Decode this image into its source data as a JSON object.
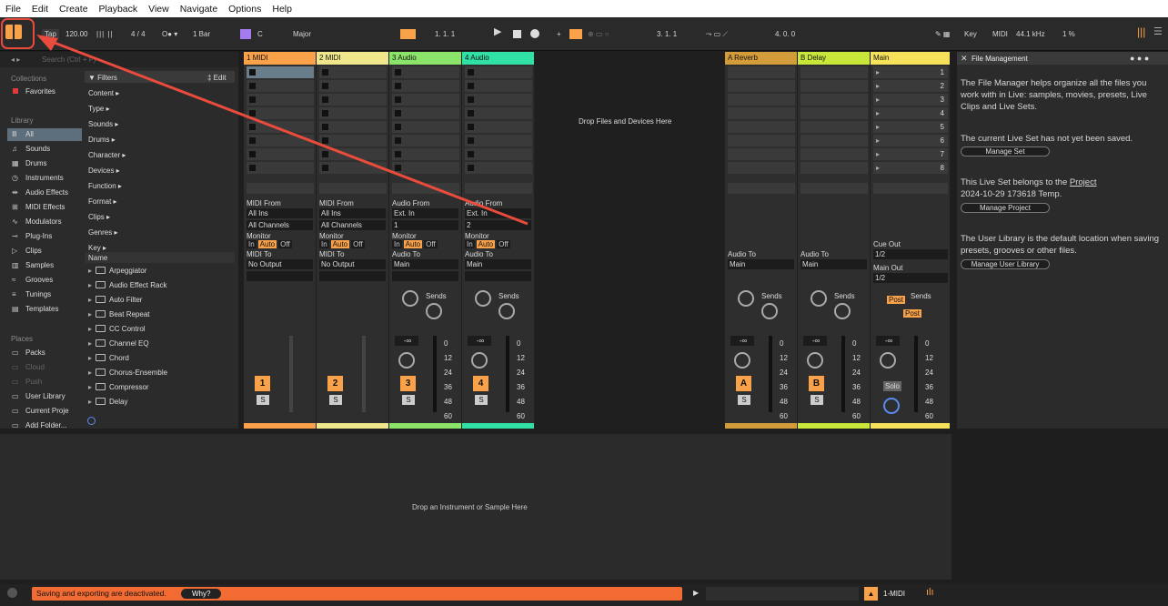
{
  "menu": [
    "File",
    "Edit",
    "Create",
    "Playback",
    "View",
    "Navigate",
    "Options",
    "Help"
  ],
  "toolbar": {
    "tap": "Tap",
    "tempo": "120.00",
    "sig": "4 / 4",
    "quant": "1 Bar",
    "key": "C",
    "scale": "Major",
    "pos1": "1.   1.   1",
    "pos2": "3.   1.   1",
    "pos3": "4.   0.   0",
    "key_label": "Key",
    "midi_label": "MIDI",
    "rate": "44.1 kHz",
    "cpu": "1 %"
  },
  "browser": {
    "search_placeholder": "Search (Ctrl + F)",
    "collections_head": "Collections",
    "favorites": "Favorites",
    "library_head": "Library",
    "library": [
      "All",
      "Sounds",
      "Drums",
      "Instruments",
      "Audio Effects",
      "MIDI Effects",
      "Modulators",
      "Plug-Ins",
      "Clips",
      "Samples",
      "Grooves",
      "Tunings",
      "Templates"
    ],
    "places_head": "Places",
    "places": [
      "Packs",
      "Cloud",
      "Push",
      "User Library",
      "Current Proje",
      "Add Folder..."
    ],
    "filters_label": "Filters",
    "edit_label": "Edit",
    "filters": [
      "Content ▸",
      "Type ▸",
      "Sounds ▸",
      "Drums ▸",
      "Character ▸",
      "Devices ▸",
      "Function ▸",
      "Format ▸",
      "Clips ▸",
      "Genres ▸",
      "Key ▸"
    ],
    "name_col": "Name",
    "devices": [
      "Arpeggiator",
      "Audio Effect Rack",
      "Auto Filter",
      "Beat Repeat",
      "CC Control",
      "Channel EQ",
      "Chord",
      "Chorus-Ensemble",
      "Compressor",
      "Delay"
    ]
  },
  "tracks": [
    {
      "name": "1 MIDI",
      "color": "#f9a24a",
      "from": "MIDI From",
      "in": "All Ins",
      "ch": "All Channels",
      "to": "MIDI To",
      "out": "No Output",
      "num": "1"
    },
    {
      "name": "2 MIDI",
      "color": "#f0e68c",
      "from": "MIDI From",
      "in": "All Ins",
      "ch": "All Channels",
      "to": "MIDI To",
      "out": "No Output",
      "num": "2"
    },
    {
      "name": "3 Audio",
      "color": "#8be36a",
      "from": "Audio From",
      "in": "Ext. In",
      "ch": "1",
      "to": "Audio To",
      "out": "Main",
      "num": "3"
    },
    {
      "name": "4 Audio",
      "color": "#31e0a4",
      "from": "Audio From",
      "in": "Ext. In",
      "ch": "2",
      "to": "Audio To",
      "out": "Main",
      "num": "4"
    }
  ],
  "returns": [
    {
      "name": "A Reverb",
      "color": "#d39c3a",
      "to": "Audio To",
      "out": "Main",
      "num": "A"
    },
    {
      "name": "B Delay",
      "color": "#c9e63a",
      "to": "Audio To",
      "out": "Main",
      "num": "B"
    }
  ],
  "main": {
    "name": "Main",
    "color": "#f5e25a",
    "scenes": [
      "1",
      "2",
      "3",
      "4",
      "5",
      "6",
      "7",
      "8"
    ],
    "cue": "Cue Out",
    "cue_val": "1/2",
    "main_out": "Main Out",
    "main_val": "1/2",
    "solo": "Solo",
    "post": "Post"
  },
  "mixer": {
    "monitor": "Monitor",
    "in": "In",
    "auto": "Auto",
    "off": "Off",
    "sends": "Sends",
    "inf": "-∞",
    "s": "S",
    "scale": [
      "0",
      "12",
      "24",
      "36",
      "48",
      "60"
    ]
  },
  "drop_files": "Drop Files and Devices Here",
  "drop_instrument": "Drop an Instrument or Sample Here",
  "info": {
    "title": "File Management",
    "p1": "The File Manager helps organize all the files you work with in Live: samples, movies, presets, Live Clips and Live Sets.",
    "p2": "The current Live Set has not yet been saved.",
    "b1": "Manage Set",
    "p3a": "This Live Set belongs to the",
    "p3link": "Project",
    "p3b": "2024-10-29 173618 Temp.",
    "b2": "Manage Project",
    "p4": "The User Library is the default location when saving presets, grooves or other files.",
    "b3": "Manage User Library"
  },
  "status": {
    "warning": "Saving and exporting are deactivated.",
    "why": "Why?",
    "track": "1-MIDI"
  }
}
